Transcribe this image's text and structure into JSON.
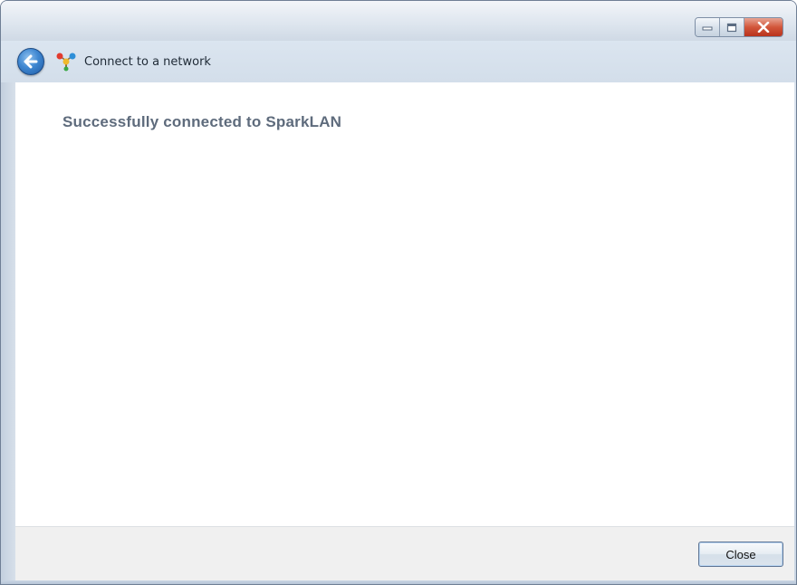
{
  "window": {
    "nav_title": "Connect to a network"
  },
  "content": {
    "heading": "Successfully connected to SparkLAN"
  },
  "footer": {
    "close_label": "Close"
  },
  "icons": {
    "back": "back-arrow-icon",
    "network": "network-connection-icon",
    "minimize": "minimize-icon",
    "maximize": "maximize-icon",
    "close": "close-x-icon"
  },
  "colors": {
    "heading_text": "#5e6b7c",
    "close_button_red": "#d2563b",
    "back_button_blue": "#3f87d1"
  }
}
